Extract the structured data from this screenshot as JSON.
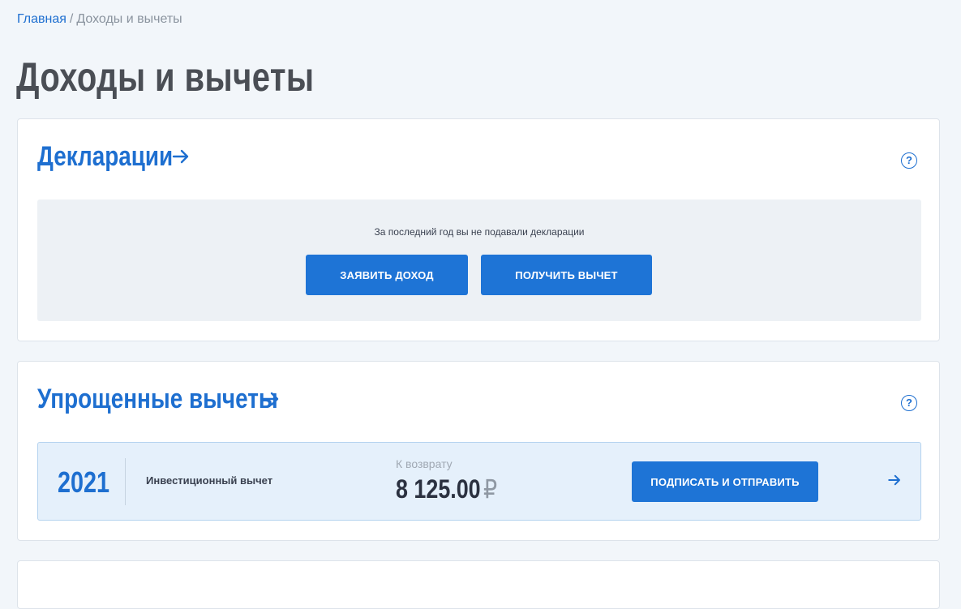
{
  "breadcrumb": {
    "home": "Главная",
    "separator": "/",
    "current": "Доходы и вычеты"
  },
  "page": {
    "title": "Доходы и вычеты"
  },
  "declarations": {
    "title": "Декларации",
    "help_icon": "question-circle-icon",
    "empty_text": "За последний год вы не подавали декларации",
    "declare_income_label": "Заявить доход",
    "get_deduction_label": "Получить вычет"
  },
  "simplified": {
    "title": "Упрощенные вычеты",
    "help_icon": "question-circle-icon",
    "items": [
      {
        "year": "2021",
        "type": "Инвестиционный вычет",
        "refund_label": "К возврату",
        "amount": "8 125.00",
        "currency": "₽",
        "action_label": "Подписать и отправить"
      }
    ]
  },
  "colors": {
    "accent": "#1e74d6",
    "link": "#1e6fd0",
    "background": "#f2f6fa"
  }
}
